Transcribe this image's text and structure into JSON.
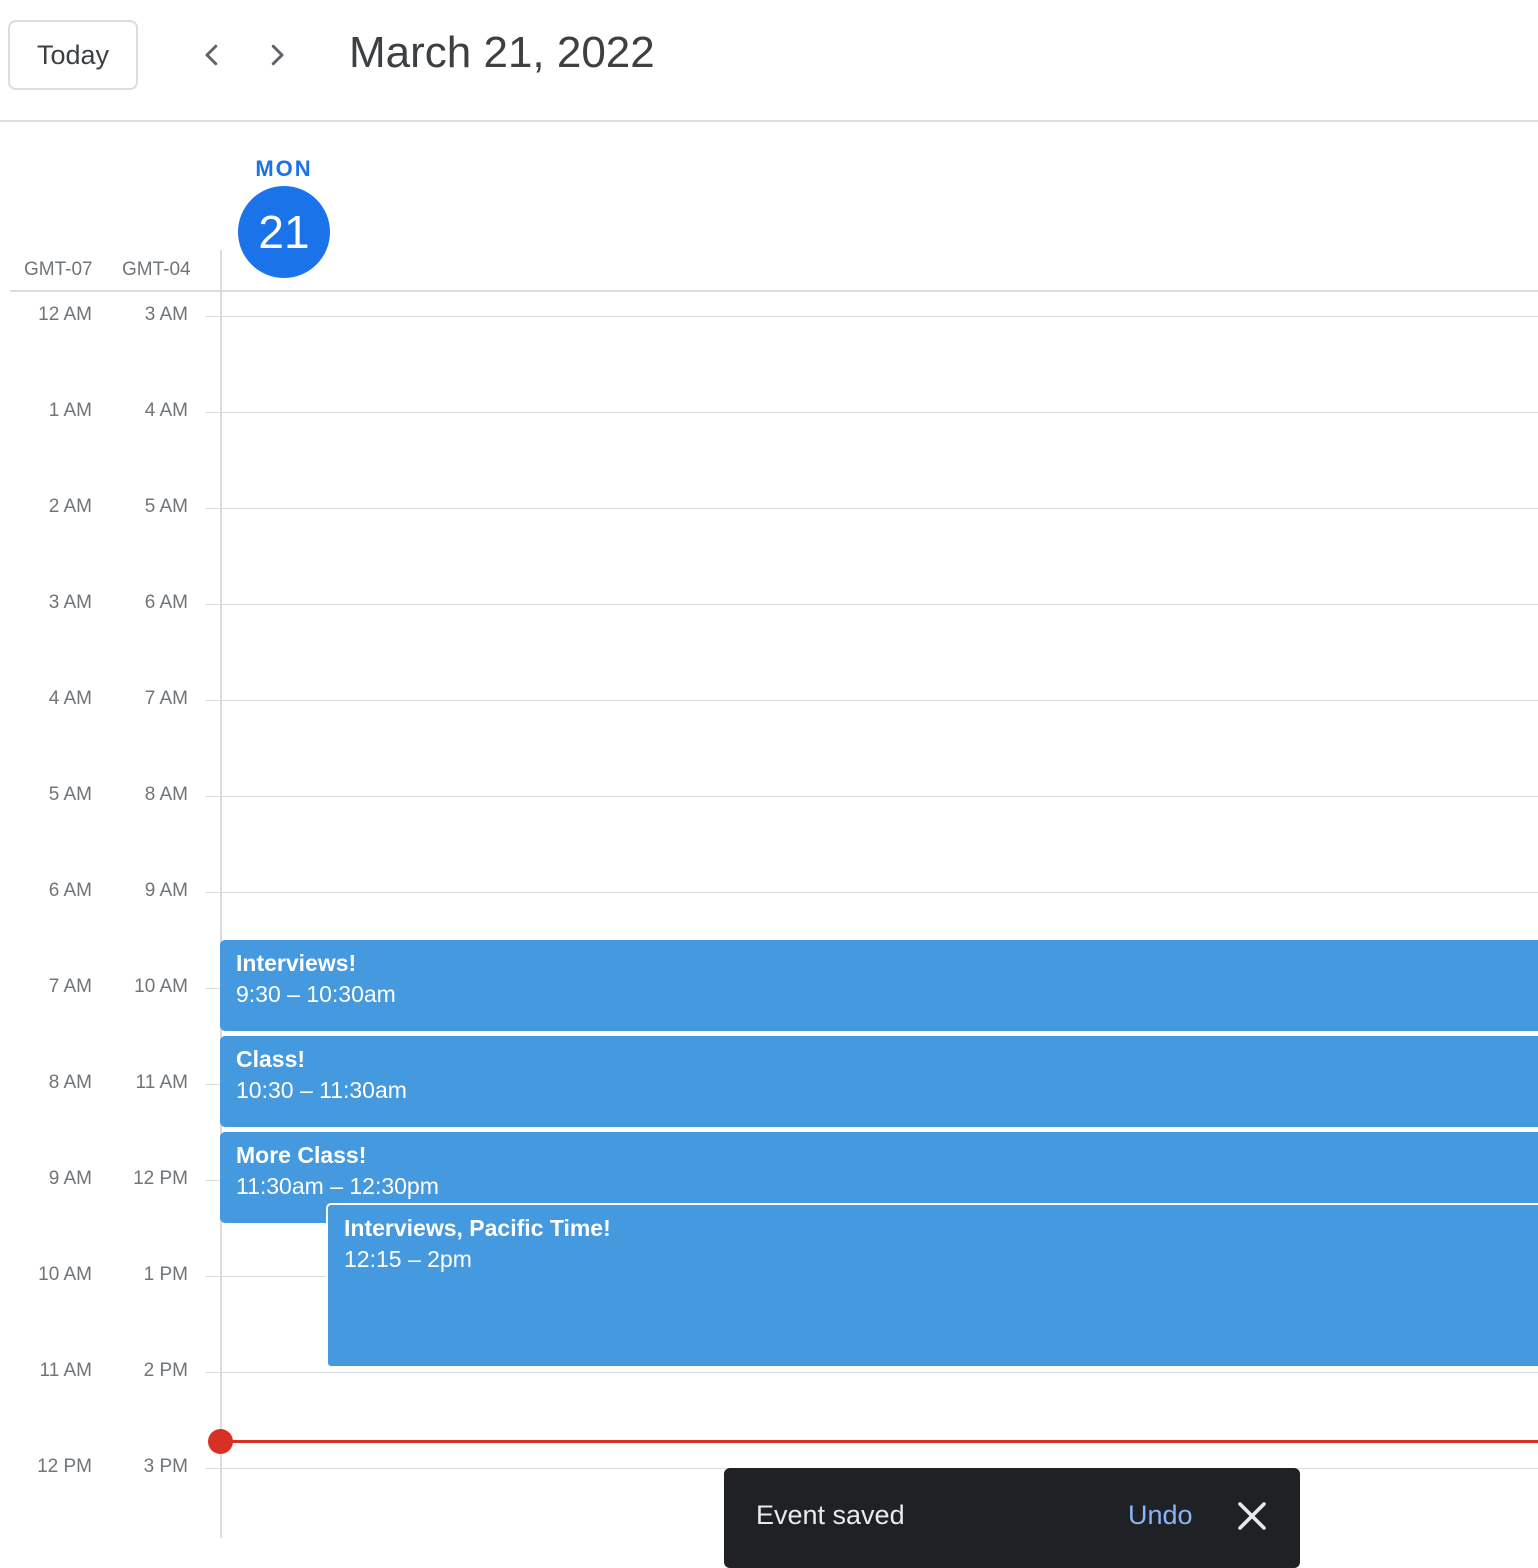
{
  "header": {
    "today_label": "Today",
    "prev_icon": "chevron-left-icon",
    "next_icon": "chevron-right-icon",
    "date_title": "March 21, 2022"
  },
  "day": {
    "name": "MON",
    "number": "21"
  },
  "timezones": {
    "primary": "GMT-07",
    "secondary": "GMT-04"
  },
  "hours": [
    {
      "a": "12 AM",
      "b": "3 AM"
    },
    {
      "a": "1 AM",
      "b": "4 AM"
    },
    {
      "a": "2 AM",
      "b": "5 AM"
    },
    {
      "a": "3 AM",
      "b": "6 AM"
    },
    {
      "a": "4 AM",
      "b": "7 AM"
    },
    {
      "a": "5 AM",
      "b": "8 AM"
    },
    {
      "a": "6 AM",
      "b": "9 AM"
    },
    {
      "a": "7 AM",
      "b": "10 AM"
    },
    {
      "a": "8 AM",
      "b": "11 AM"
    },
    {
      "a": "9 AM",
      "b": "12 PM"
    },
    {
      "a": "10 AM",
      "b": "1 PM"
    },
    {
      "a": "11 AM",
      "b": "2 PM"
    },
    {
      "a": "12 PM",
      "b": "3 PM"
    }
  ],
  "events": [
    {
      "title": "Interviews!",
      "time": "9:30 – 10:30am"
    },
    {
      "title": "Class!",
      "time": "10:30 – 11:30am"
    },
    {
      "title": "More Class!",
      "time": "11:30am – 12:30pm"
    },
    {
      "title": "Interviews, Pacific Time!",
      "time": "12:15 – 2pm"
    }
  ],
  "colors": {
    "event": "#4599df",
    "accent": "#1a73e8",
    "now_line": "#d93025"
  },
  "snackbar": {
    "text": "Event saved",
    "action": "Undo",
    "close_icon": "close-icon"
  }
}
